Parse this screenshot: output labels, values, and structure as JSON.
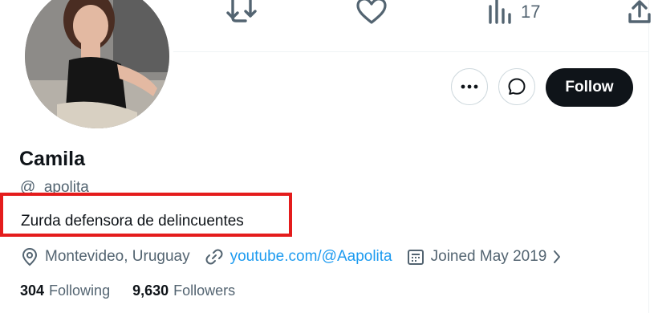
{
  "actions": {
    "views_count": "17"
  },
  "profile": {
    "display_name": "Camila",
    "handle": "@_apolita",
    "bio": "Zurda defensora de delincuentes",
    "location": "Montevideo, Uruguay",
    "website": "youtube.com/@Aapolita",
    "joined": "Joined May 2019",
    "following_count": "304",
    "following_label": "Following",
    "followers_count": "9,630",
    "followers_label": "Followers"
  },
  "buttons": {
    "follow_label": "Follow"
  },
  "icons": {
    "retweet": "retweet-icon",
    "like": "heart-icon",
    "views": "bar-chart-icon",
    "share": "share-icon",
    "more": "more-icon",
    "message": "message-icon",
    "location": "location-pin-icon",
    "link": "link-icon",
    "calendar": "calendar-icon"
  },
  "colors": {
    "accent": "#1d9bf0",
    "follow_button_bg": "#0f1419",
    "highlight_box": "#e41c1c",
    "secondary_text": "#536471"
  }
}
